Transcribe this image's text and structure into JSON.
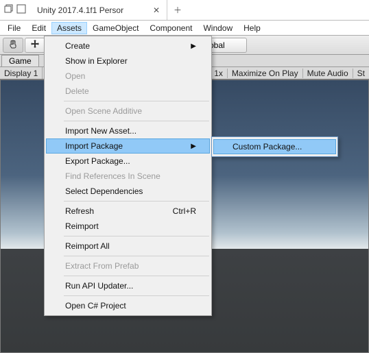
{
  "title": "Unity 2017.4.1f1 Persor",
  "menubar": [
    "File",
    "Edit",
    "Assets",
    "GameObject",
    "Component",
    "Window",
    "Help"
  ],
  "menubar_open_index": 2,
  "toolbar_obscured_text": "obal",
  "game_tab": "Game",
  "opts_left": "Display 1",
  "opts_right": {
    "scale1x": "1x",
    "maximize": "Maximize On Play",
    "mute": "Mute Audio",
    "stats": "St"
  },
  "assets_menu": {
    "create": "Create",
    "show_explorer": "Show in Explorer",
    "open": "Open",
    "delete": "Delete",
    "open_scene_additive": "Open Scene Additive",
    "import_new_asset": "Import New Asset...",
    "import_package": "Import Package",
    "export_package": "Export Package...",
    "find_refs": "Find References In Scene",
    "select_deps": "Select Dependencies",
    "refresh": "Refresh",
    "refresh_shortcut": "Ctrl+R",
    "reimport": "Reimport",
    "reimport_all": "Reimport All",
    "extract_prefab": "Extract From Prefab",
    "run_api": "Run API Updater...",
    "open_csharp": "Open C# Project"
  },
  "submenu": {
    "custom_package": "Custom Package..."
  }
}
